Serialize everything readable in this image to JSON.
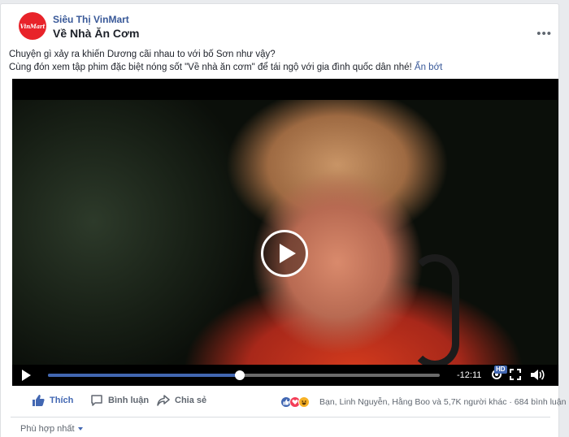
{
  "page": {
    "name": "Siêu Thị VinMart",
    "logo_text": "VinMart",
    "more_icon": "more-options-icon"
  },
  "post": {
    "title": "Về Nhà Ăn Cơm",
    "text_line1": "Chuyện gì xảy ra khiến Dương cãi nhau to với bố Sơn như vậy?",
    "text_line2": "Cùng đón xem tập phim đặc biệt nóng sốt \"Về nhà ăn cơm\" để tái ngộ với gia đình quốc dân nhé!",
    "see_less": "Ẩn bớt"
  },
  "video": {
    "time_remaining": "-12:11",
    "quality_badge": "HD",
    "progress_fraction": 0.49
  },
  "actions": {
    "like_label": "Thích",
    "comment_label": "Bình luận",
    "share_label": "Chia sẻ"
  },
  "reactions": {
    "summary": "Bạn, Linh Nguyễn, Hằng Boo và 5,7K người khác · 684 bình luận",
    "types": [
      "like",
      "love",
      "haha"
    ]
  },
  "comments": {
    "sort_label": "Phù hợp nhất"
  },
  "colors": {
    "link": "#385898",
    "accent": "#4267b2",
    "brand_red": "#e8232a"
  }
}
